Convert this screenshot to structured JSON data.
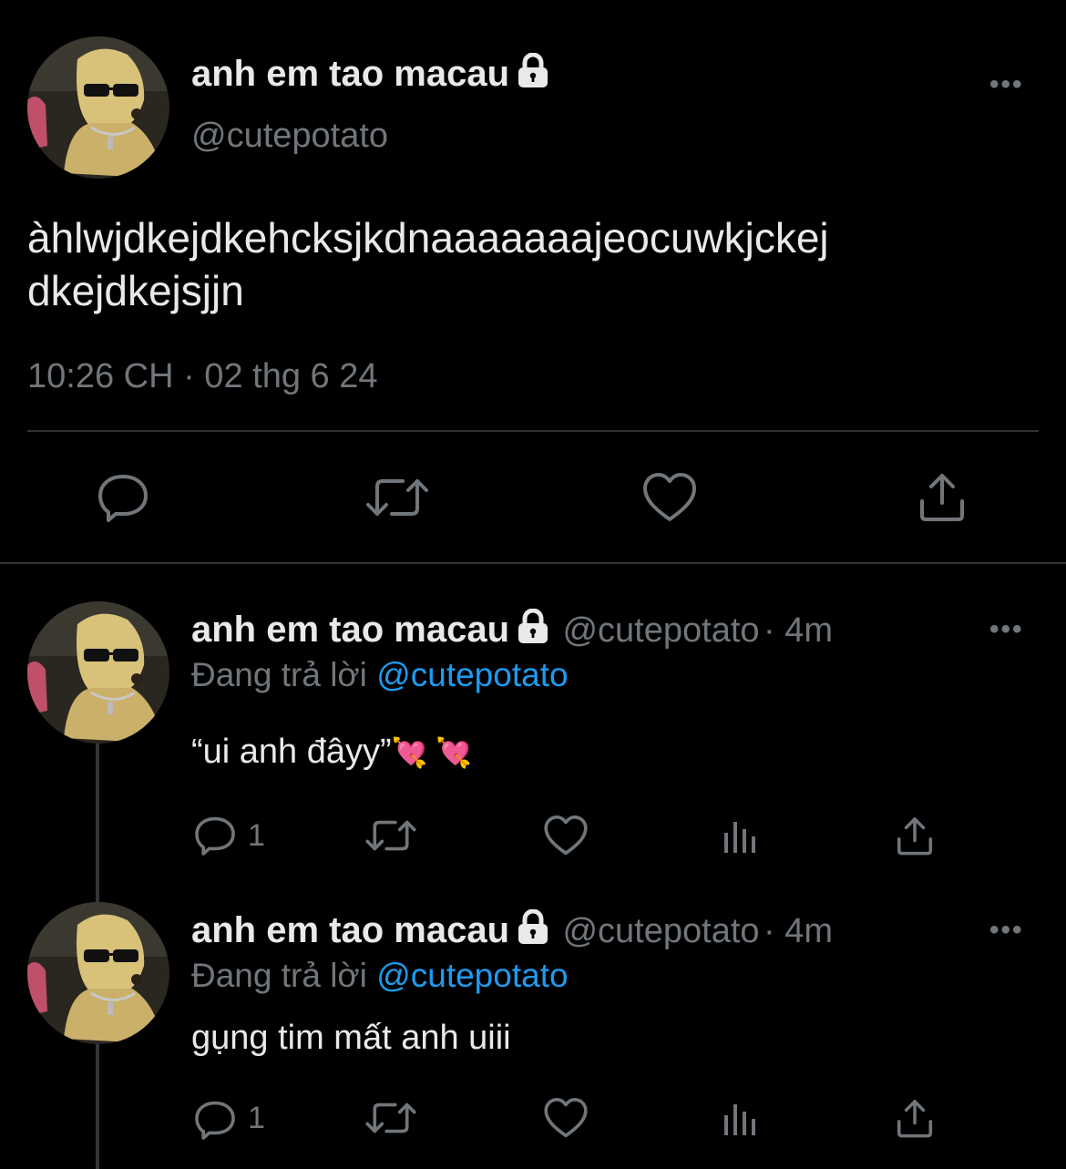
{
  "main_tweet": {
    "display_name": "anh em tao macau",
    "handle": "@cutepotato",
    "text": "àhlwjdkejdkehcksjkdnaaaaaaajeocuwkjckej dkejdkejsjjn",
    "timestamp": "10:26 CH · 02 thg 6 24",
    "more_label": "•••"
  },
  "replies": [
    {
      "display_name": "anh em tao macau",
      "handle": "@cutepotato",
      "time": "· 4m",
      "replying_prefix": "Đang trả lời",
      "replying_to": "@cutepotato",
      "text": "“ui anh đâyy”",
      "emoji": "💘 💘",
      "reply_count": "1",
      "more_label": "•••"
    },
    {
      "display_name": "anh em tao macau",
      "handle": "@cutepotato",
      "time": "· 4m",
      "replying_prefix": "Đang trả lời",
      "replying_to": "@cutepotato",
      "text": "gụng tim mất anh uiii",
      "reply_count": "1",
      "more_label": "•••"
    }
  ],
  "icons": {
    "lock": "lock-icon",
    "reply": "reply-icon",
    "retweet": "retweet-icon",
    "like": "like-icon",
    "share": "share-icon",
    "views": "views-icon"
  },
  "colors": {
    "background": "#000000",
    "text": "#e7e9ea",
    "muted": "#71767b",
    "link": "#1d9bf0",
    "divider": "#2f3336"
  }
}
